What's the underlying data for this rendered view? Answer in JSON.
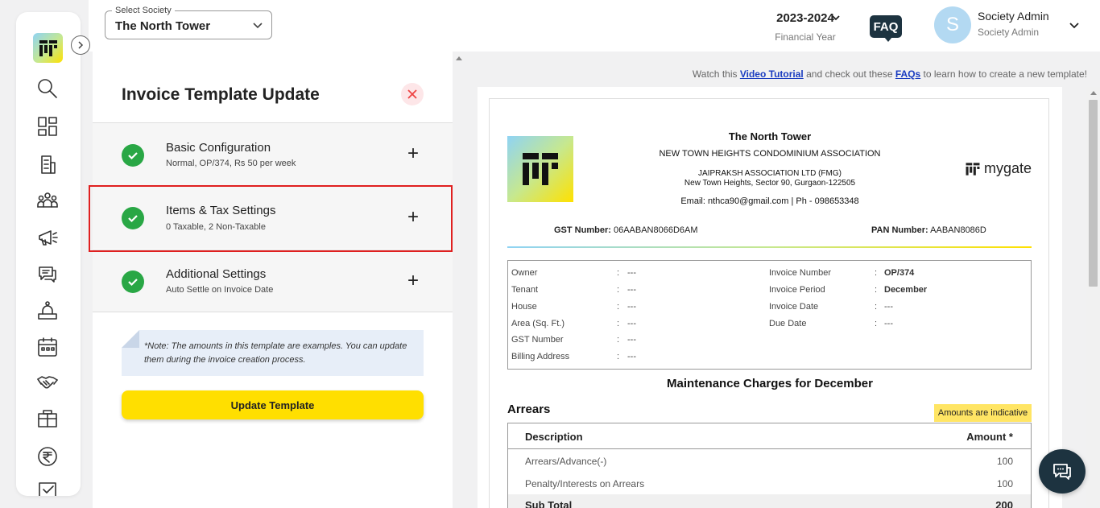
{
  "header": {
    "society_label": "Select Society",
    "society_value": "The North Tower",
    "financial_year": "2023-2024",
    "financial_year_label": "Financial Year",
    "faq_label": "FAQ",
    "avatar_initial": "S",
    "user_name": "Society Admin",
    "user_role": "Society Admin"
  },
  "sidebar": {
    "items": [
      "search-icon",
      "dashboard-icon",
      "building-icon",
      "community-icon",
      "announcement-icon",
      "chat-icon",
      "helpdesk-icon",
      "calendar-icon",
      "handshake-icon",
      "amenity-icon",
      "rupee-icon",
      "checkbox-icon"
    ]
  },
  "panel": {
    "title": "Invoice Template Update",
    "sections": [
      {
        "title": "Basic Configuration",
        "subtitle": "Normal, OP/374, Rs 50 per week"
      },
      {
        "title": "Items & Tax Settings",
        "subtitle": "0 Taxable, 2 Non-Taxable"
      },
      {
        "title": "Additional Settings",
        "subtitle": "Auto Settle on Invoice Date"
      }
    ],
    "note": "*Note: The amounts in this template are examples. You can update them during the invoice creation process.",
    "update_button": "Update Template"
  },
  "tutorial": {
    "prefix": "Watch this",
    "video_link": "Video Tutorial",
    "middle": "and check out these",
    "faq_link": "FAQs",
    "suffix": "to learn how to create a new template!"
  },
  "invoice": {
    "society_name": "The North Tower",
    "association": "NEW TOWN HEIGHTS CONDOMINIUM ASSOCIATION",
    "company": "JAIPRAKSH ASSOCIATION LTD (FMG)",
    "address": "New Town Heights, Sector 90, Gurgaon-122505",
    "contact": "Email: nthca90@gmail.com | Ph - 098653348",
    "brand": "mygate",
    "gst_label": "GST Number:",
    "gst_value": "06AABAN8066D6AM",
    "pan_label": "PAN Number:",
    "pan_value": "AABAN8086D",
    "left_fields": [
      {
        "label": "Owner",
        "value": "---"
      },
      {
        "label": "Tenant",
        "value": "---"
      },
      {
        "label": "House",
        "value": "---"
      },
      {
        "label": "Area (Sq. Ft.)",
        "value": "---"
      },
      {
        "label": "GST Number",
        "value": "---"
      },
      {
        "label": "Billing Address",
        "value": "---"
      }
    ],
    "right_fields": [
      {
        "label": "Invoice Number",
        "value": "OP/374"
      },
      {
        "label": "Invoice Period",
        "value": "December"
      },
      {
        "label": "Invoice Date",
        "value": "---"
      },
      {
        "label": "Due Date",
        "value": "---"
      }
    ],
    "charges_title": "Maintenance Charges for December",
    "arrears_title": "Arrears",
    "indicative_badge": "Amounts are indicative",
    "table_headers": {
      "description": "Description",
      "amount": "Amount *"
    },
    "rows": [
      {
        "description": "Arrears/Advance(-)",
        "amount": "100"
      },
      {
        "description": "Penalty/Interests on Arrears",
        "amount": "100"
      }
    ],
    "subtotal_label": "Sub Total",
    "subtotal_value": "200"
  }
}
